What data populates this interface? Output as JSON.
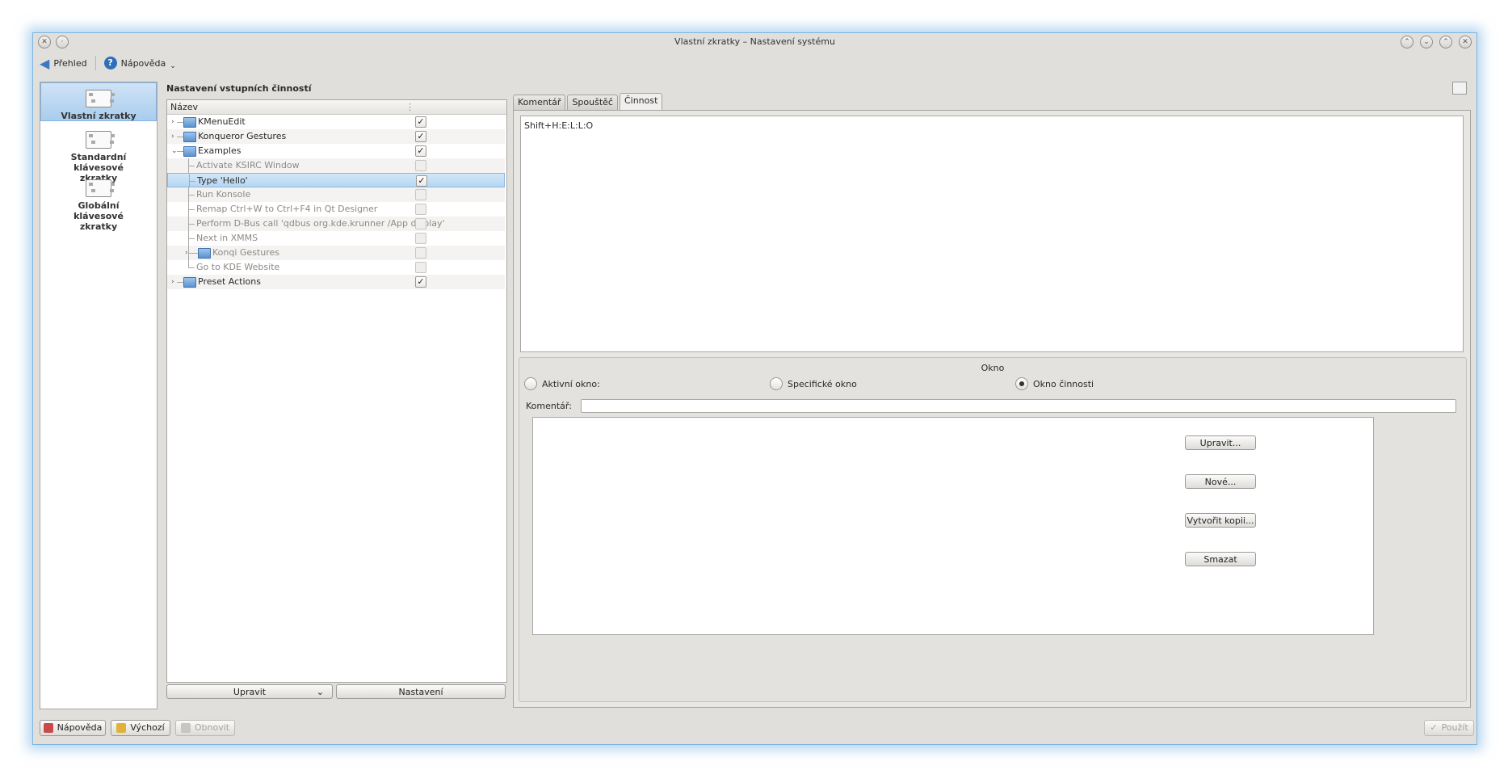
{
  "window": {
    "title": "Vlastní zkratky – Nastavení systému"
  },
  "toolbar": {
    "overview": "Přehled",
    "help": "Nápověda"
  },
  "sidebar": {
    "items": [
      {
        "label": "Vlastní zkratky"
      },
      {
        "label": "Standardní klávesové zkratky"
      },
      {
        "label": "Globální klávesové zkratky"
      }
    ]
  },
  "heading": "Nastavení vstupních činností",
  "tree": {
    "column": "Název",
    "rows": [
      {
        "label": "KMenuEdit",
        "checked": true
      },
      {
        "label": "Konqueror Gestures",
        "checked": true
      },
      {
        "label": "Examples",
        "checked": true
      },
      {
        "label": "Activate KSIRC Window",
        "checked": false
      },
      {
        "label": "Type 'Hello'",
        "checked": true
      },
      {
        "label": "Run Konsole",
        "checked": false
      },
      {
        "label": "Remap Ctrl+W to Ctrl+F4 in Qt Designer",
        "checked": false
      },
      {
        "label": "Perform D-Bus call 'qdbus org.kde.krunner /App display'",
        "checked": false
      },
      {
        "label": "Next in XMMS",
        "checked": false
      },
      {
        "label": "Konqi Gestures",
        "checked": false
      },
      {
        "label": "Go to KDE Website",
        "checked": false
      },
      {
        "label": "Preset Actions",
        "checked": true
      }
    ],
    "edit_button": "Upravit",
    "settings_button": "Nastavení"
  },
  "tabs": [
    "Komentář",
    "Spouštěč",
    "Činnost"
  ],
  "action": {
    "text": "Shift+H:E:L:L:O",
    "group_title": "Okno",
    "radio_active": "Aktivní okno:",
    "radio_specific": "Specifické okno",
    "radio_action": "Okno činnosti",
    "comment_label": "Komentář:",
    "btn_edit": "Upravit...",
    "btn_new": "Nové...",
    "btn_copy": "Vytvořit kopii...",
    "btn_delete": "Smazat"
  },
  "footer": {
    "help": "Nápověda",
    "defaults": "Výchozí",
    "reset": "Obnovit",
    "apply": "Použít"
  }
}
